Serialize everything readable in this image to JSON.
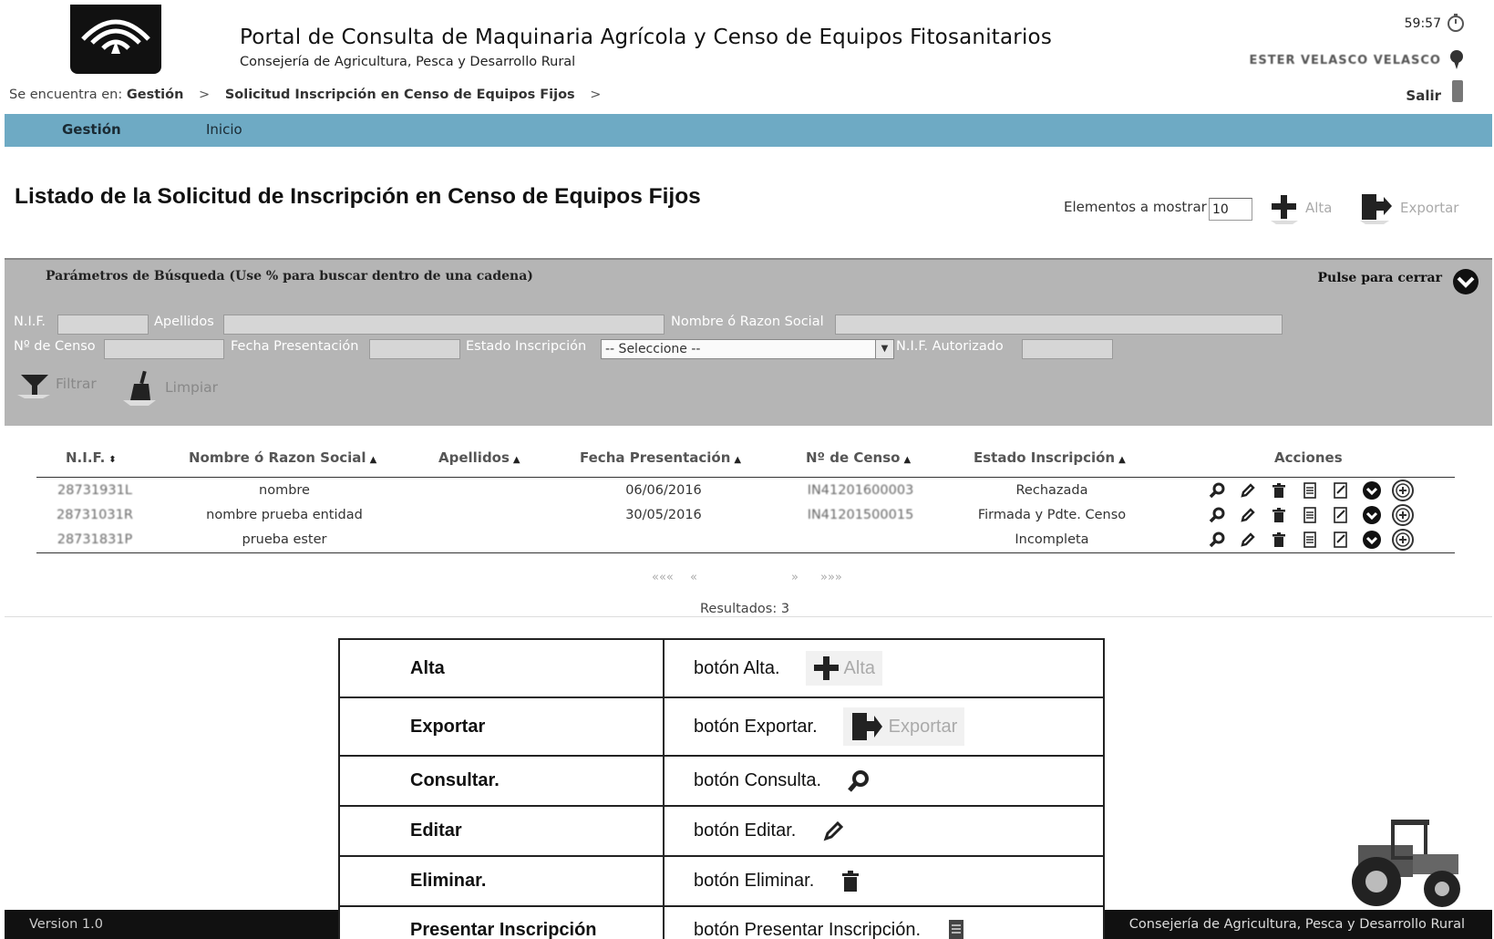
{
  "header": {
    "title": "Portal de Consulta de Maquinaria Agrícola y Censo de Equipos Fitosanitarios",
    "subtitle": "Consejería de Agricultura, Pesca y Desarrollo Rural",
    "clock": "59:57",
    "user_name": "ESTER VELASCO VELASCO",
    "logout_label": "Salir"
  },
  "breadcrumb": {
    "prefix": "Se encuentra en:",
    "items": [
      "Gestión",
      "Solicitud Inscripción en Censo de Equipos Fijos"
    ],
    "separator": ">"
  },
  "nav": {
    "items": [
      "Gestión",
      "Inicio"
    ]
  },
  "page": {
    "title": "Listado de la Solicitud de Inscripción en Censo de Equipos Fijos",
    "elements_label": "Elementos a mostrar",
    "elements_value": "10",
    "add_label": "Alta",
    "export_label": "Exportar"
  },
  "search": {
    "title": "Parámetros de Búsqueda (Use % para buscar dentro de una cadena)",
    "close_label": "Pulse para cerrar",
    "labels": {
      "nif": "N.I.F.",
      "apellidos": "Apellidos",
      "nombre": "Nombre ó Razon Social",
      "censo": "Nº de Censo",
      "fecha": "Fecha Presentación",
      "estado": "Estado Inscripción",
      "nif_aut": "N.I.F. Autorizado"
    },
    "estado_selected": "-- Seleccione --",
    "filter_label": "Filtrar",
    "clear_label": "Limpiar"
  },
  "table": {
    "headers": [
      "N.I.F.",
      "Nombre ó Razon Social",
      "Apellidos",
      "Fecha Presentación",
      "Nº de Censo",
      "Estado Inscripción",
      "Acciones"
    ],
    "rows": [
      {
        "nif": "28731931L",
        "nombre": "nombre",
        "apellidos": "",
        "fecha": "06/06/2016",
        "censo": "IN41201600003",
        "estado": "Rechazada"
      },
      {
        "nif": "28731031R",
        "nombre": "nombre prueba entidad",
        "apellidos": "",
        "fecha": "30/05/2016",
        "censo": "IN41201500015",
        "estado": "Firmada y Pdte. Censo"
      },
      {
        "nif": "28731831P",
        "nombre": "prueba ester",
        "apellidos": "",
        "fecha": "",
        "censo": "",
        "estado": "Incompleta"
      }
    ],
    "action_icons": [
      "search-icon",
      "edit-icon",
      "trash-icon",
      "document-icon",
      "signed-document-icon",
      "download-icon",
      "add-circle-icon"
    ]
  },
  "pager": {
    "first": "«««",
    "prev": "«",
    "next": "»",
    "last": "»»»",
    "results": "Resultados: 3"
  },
  "legend": {
    "rows": [
      {
        "key": "Alta",
        "desc": "botón Alta.",
        "demo": "Alta"
      },
      {
        "key": "Exportar",
        "desc": "botón Exportar.",
        "demo": "Exportar"
      },
      {
        "key": "Consultar.",
        "desc": "botón Consulta.",
        "demo": ""
      },
      {
        "key": "Editar",
        "desc": "botón Editar.",
        "demo": ""
      },
      {
        "key": "Eliminar.",
        "desc": "botón Eliminar.",
        "demo": ""
      },
      {
        "key": "Presentar Inscripción",
        "desc": "botón Presentar Inscripción.",
        "demo": ""
      }
    ]
  },
  "footer": {
    "version": "Version 1.0",
    "org": "Consejería de Agricultura, Pesca y Desarrollo Rural"
  },
  "colors": {
    "nav_bar": "#6eaac4",
    "search_panel": "#b5b5b5",
    "footer": "#111111"
  }
}
